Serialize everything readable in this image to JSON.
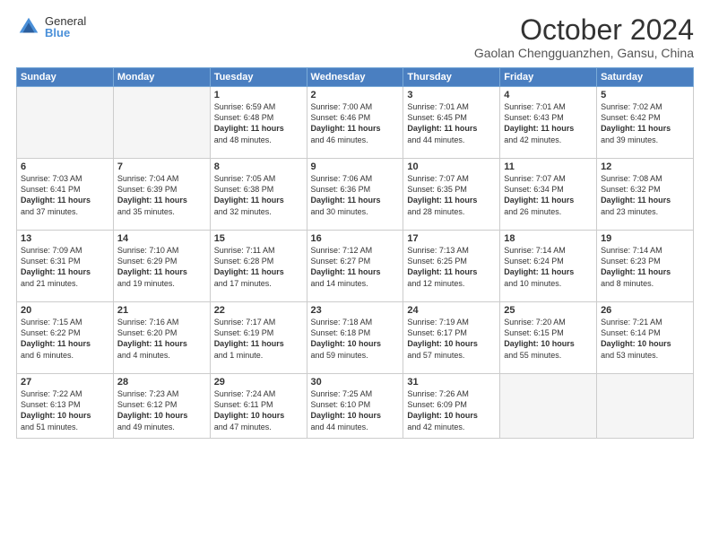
{
  "logo": {
    "general": "General",
    "blue": "Blue"
  },
  "header": {
    "month": "October 2024",
    "location": "Gaolan Chengguanzhen, Gansu, China"
  },
  "weekdays": [
    "Sunday",
    "Monday",
    "Tuesday",
    "Wednesday",
    "Thursday",
    "Friday",
    "Saturday"
  ],
  "weeks": [
    [
      {
        "day": "",
        "content": ""
      },
      {
        "day": "",
        "content": ""
      },
      {
        "day": "1",
        "content": "Sunrise: 6:59 AM\nSunset: 6:48 PM\nDaylight: 11 hours\nand 48 minutes."
      },
      {
        "day": "2",
        "content": "Sunrise: 7:00 AM\nSunset: 6:46 PM\nDaylight: 11 hours\nand 46 minutes."
      },
      {
        "day": "3",
        "content": "Sunrise: 7:01 AM\nSunset: 6:45 PM\nDaylight: 11 hours\nand 44 minutes."
      },
      {
        "day": "4",
        "content": "Sunrise: 7:01 AM\nSunset: 6:43 PM\nDaylight: 11 hours\nand 42 minutes."
      },
      {
        "day": "5",
        "content": "Sunrise: 7:02 AM\nSunset: 6:42 PM\nDaylight: 11 hours\nand 39 minutes."
      }
    ],
    [
      {
        "day": "6",
        "content": "Sunrise: 7:03 AM\nSunset: 6:41 PM\nDaylight: 11 hours\nand 37 minutes."
      },
      {
        "day": "7",
        "content": "Sunrise: 7:04 AM\nSunset: 6:39 PM\nDaylight: 11 hours\nand 35 minutes."
      },
      {
        "day": "8",
        "content": "Sunrise: 7:05 AM\nSunset: 6:38 PM\nDaylight: 11 hours\nand 32 minutes."
      },
      {
        "day": "9",
        "content": "Sunrise: 7:06 AM\nSunset: 6:36 PM\nDaylight: 11 hours\nand 30 minutes."
      },
      {
        "day": "10",
        "content": "Sunrise: 7:07 AM\nSunset: 6:35 PM\nDaylight: 11 hours\nand 28 minutes."
      },
      {
        "day": "11",
        "content": "Sunrise: 7:07 AM\nSunset: 6:34 PM\nDaylight: 11 hours\nand 26 minutes."
      },
      {
        "day": "12",
        "content": "Sunrise: 7:08 AM\nSunset: 6:32 PM\nDaylight: 11 hours\nand 23 minutes."
      }
    ],
    [
      {
        "day": "13",
        "content": "Sunrise: 7:09 AM\nSunset: 6:31 PM\nDaylight: 11 hours\nand 21 minutes."
      },
      {
        "day": "14",
        "content": "Sunrise: 7:10 AM\nSunset: 6:29 PM\nDaylight: 11 hours\nand 19 minutes."
      },
      {
        "day": "15",
        "content": "Sunrise: 7:11 AM\nSunset: 6:28 PM\nDaylight: 11 hours\nand 17 minutes."
      },
      {
        "day": "16",
        "content": "Sunrise: 7:12 AM\nSunset: 6:27 PM\nDaylight: 11 hours\nand 14 minutes."
      },
      {
        "day": "17",
        "content": "Sunrise: 7:13 AM\nSunset: 6:25 PM\nDaylight: 11 hours\nand 12 minutes."
      },
      {
        "day": "18",
        "content": "Sunrise: 7:14 AM\nSunset: 6:24 PM\nDaylight: 11 hours\nand 10 minutes."
      },
      {
        "day": "19",
        "content": "Sunrise: 7:14 AM\nSunset: 6:23 PM\nDaylight: 11 hours\nand 8 minutes."
      }
    ],
    [
      {
        "day": "20",
        "content": "Sunrise: 7:15 AM\nSunset: 6:22 PM\nDaylight: 11 hours\nand 6 minutes."
      },
      {
        "day": "21",
        "content": "Sunrise: 7:16 AM\nSunset: 6:20 PM\nDaylight: 11 hours\nand 4 minutes."
      },
      {
        "day": "22",
        "content": "Sunrise: 7:17 AM\nSunset: 6:19 PM\nDaylight: 11 hours\nand 1 minute."
      },
      {
        "day": "23",
        "content": "Sunrise: 7:18 AM\nSunset: 6:18 PM\nDaylight: 10 hours\nand 59 minutes."
      },
      {
        "day": "24",
        "content": "Sunrise: 7:19 AM\nSunset: 6:17 PM\nDaylight: 10 hours\nand 57 minutes."
      },
      {
        "day": "25",
        "content": "Sunrise: 7:20 AM\nSunset: 6:15 PM\nDaylight: 10 hours\nand 55 minutes."
      },
      {
        "day": "26",
        "content": "Sunrise: 7:21 AM\nSunset: 6:14 PM\nDaylight: 10 hours\nand 53 minutes."
      }
    ],
    [
      {
        "day": "27",
        "content": "Sunrise: 7:22 AM\nSunset: 6:13 PM\nDaylight: 10 hours\nand 51 minutes."
      },
      {
        "day": "28",
        "content": "Sunrise: 7:23 AM\nSunset: 6:12 PM\nDaylight: 10 hours\nand 49 minutes."
      },
      {
        "day": "29",
        "content": "Sunrise: 7:24 AM\nSunset: 6:11 PM\nDaylight: 10 hours\nand 47 minutes."
      },
      {
        "day": "30",
        "content": "Sunrise: 7:25 AM\nSunset: 6:10 PM\nDaylight: 10 hours\nand 44 minutes."
      },
      {
        "day": "31",
        "content": "Sunrise: 7:26 AM\nSunset: 6:09 PM\nDaylight: 10 hours\nand 42 minutes."
      },
      {
        "day": "",
        "content": ""
      },
      {
        "day": "",
        "content": ""
      }
    ]
  ]
}
